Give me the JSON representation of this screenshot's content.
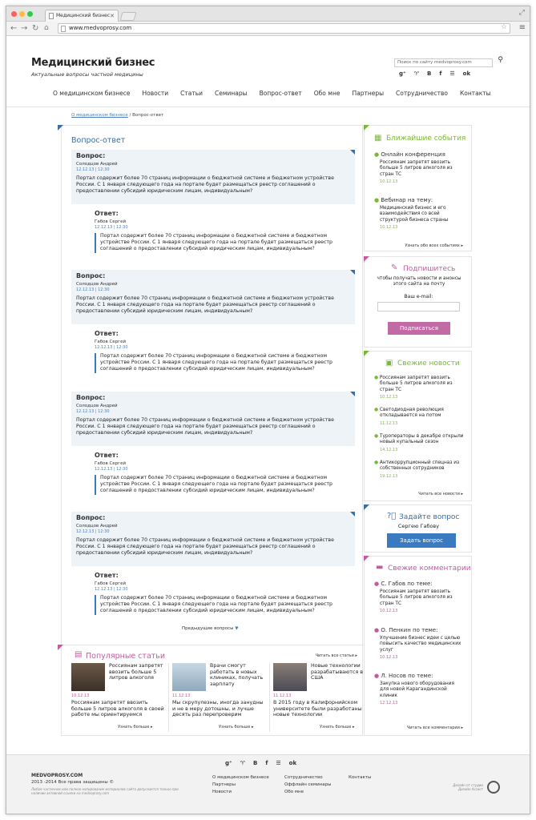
{
  "browser": {
    "tab_title": "Медицинский бизнес",
    "url": "www.medvoprosy.com"
  },
  "site": {
    "logo": "Медицинский бизнес",
    "tagline": "Актуальные вопросы частной медицины",
    "search_placeholder": "Поиск по сайту medvoprosy.com",
    "social": [
      "g⁺",
      "♈",
      "B",
      "f",
      "☰",
      "ok"
    ]
  },
  "nav": [
    "О медицинском бизнесе",
    "Новости",
    "Статьи",
    "Семинары",
    "Вопрос-ответ",
    "Обо мне",
    "Партнеры",
    "Сотрудничество",
    "Контакты"
  ],
  "breadcrumb": {
    "link": "О медицинском бизнесе",
    "sep": " / ",
    "current": "Вопрос-ответ"
  },
  "qa": {
    "title": "Вопрос-ответ",
    "q_label": "Вопрос:",
    "a_label": "Ответ:",
    "items": [
      {
        "q_author": "Солодцов Андрей",
        "q_date": "12.12.13 | 12:30",
        "q_text": "Портал содержит более 70 страниц информации о бюджетной системе и бюджетном устройстве России. С 1 января следующего года на портале будет размещаться реестр соглашений о предоставлении субсидий юридическим лицам, индивидуальным?",
        "a_author": "Габов Сергей",
        "a_date": "12.12.13 | 12:30",
        "a_text": "Портал содержит более 70 страниц информации о бюджетной системе и бюджетном устройстве России. С 1 января следующего года на портале будет размещаться реестр соглашений о предоставлении субсидий юридическим лицам, индивидуальным?"
      },
      {
        "q_author": "Солодцов Андрей",
        "q_date": "12.12.13 | 12:30",
        "q_text": "Портал содержит более 70 страниц информации о бюджетной системе и бюджетном устройстве России. С 1 января следующего года на портале будет размещаться реестр соглашений о предоставлении субсидий юридическим лицам, индивидуальным?",
        "a_author": "Габов Сергей",
        "a_date": "12.12.13 | 12:30",
        "a_text": "Портал содержит более 70 страниц информации о бюджетной системе и бюджетном устройстве России. С 1 января следующего года на портале будет размещаться реестр соглашений о предоставлении субсидий юридическим лицам, индивидуальным?"
      },
      {
        "q_author": "Солодцов Андрей",
        "q_date": "12.12.13 | 12:30",
        "q_text": "Портал содержит более 70 страниц информации о бюджетной системе и бюджетном устройстве России. С 1 января следующего года на портале будет размещаться реестр соглашений о предоставлении субсидий юридическим лицам, индивидуальным?",
        "a_author": "Габов Сергей",
        "a_date": "12.12.13 | 12:30",
        "a_text": "Портал содержит более 70 страниц информации о бюджетной системе и бюджетном устройстве России. С 1 января следующего года на портале будет размещаться реестр соглашений о предоставлении субсидий юридическим лицам, индивидуальным?"
      },
      {
        "q_author": "Солодцов Андрей",
        "q_date": "12.12.13 | 12:30",
        "q_text": "Портал содержит более 70 страниц информации о бюджетной системе и бюджетном устройстве России. С 1 января следующего года на портале будет размещаться реестр соглашений о предоставлении субсидий юридическим лицам, индивидуальным?",
        "a_author": "Габов Сергей",
        "a_date": "12.12.13 | 12:30",
        "a_text": "Портал содержит более 70 страниц информации о бюджетной системе и бюджетном устройстве России. С 1 января следующего года на портале будет размещаться реестр соглашений о предоставлении субсидий юридическим лицам, индивидуальным?"
      }
    ],
    "prev": "Предыдущие вопросы"
  },
  "popular": {
    "title": "Популярные статьи",
    "all": "Читать все статьи",
    "more": "Узнать больше",
    "cards": [
      {
        "t1": "Россиянам запретят ввозить больше 5 литров алкоголя",
        "date": "10.12.13",
        "t2": "Россиянам запретят ввозить больше 5 литров алкоголя в своей работе мы ориентируемся"
      },
      {
        "t1": "Врачи смогут работать в новых клиниках, получать зарплату",
        "date": "11.12.13",
        "t2": "Мы скрупулезны, иногда занудны и не в меру дотошны, и лучше десять раз перепроверим"
      },
      {
        "t1": "Новые технологии разрабатываются в США",
        "date": "11.12.13",
        "t2": "В 2015 году в Калифорнийском университете были разработаны новые технологии"
      }
    ]
  },
  "events": {
    "title": "Ближайшие события",
    "all": "Узнать обо всех событиях",
    "items": [
      {
        "head": "Онлайн конференция",
        "body": "Россиянам запретят ввозить больше 5 литров алкоголя из стран ТС",
        "date": "10.12.13"
      },
      {
        "head": "Вебинар на тему:",
        "body": "Медицинский бизнес и его взаимодействия со всей структурой бизнеса страны",
        "date": "10.12.13"
      }
    ]
  },
  "subscribe": {
    "title": "Подпишитесь",
    "text": "чтобы получать новости и анонсы этого сайта на почту",
    "email_label": "Ваш e-mail:",
    "button": "Подписаться"
  },
  "news": {
    "title": "Свежие новости",
    "all": "Читать все новости",
    "items": [
      {
        "body": "Россиянам запретят ввозить больше 5 литров алкоголя из стран ТС",
        "date": "10.12.13"
      },
      {
        "body": "Светодиодная революция откладывается на потом",
        "date": "11.12.13"
      },
      {
        "body": "Туроператоры в декабре открыли новый купальный сезон",
        "date": "14.12.13"
      },
      {
        "body": "Антикоррупционный спецназ из собственных сотрудников",
        "date": "19.12.13"
      }
    ]
  },
  "ask": {
    "title": "Задайте вопрос",
    "sub": "Сергею Габову",
    "button": "Задать вопрос"
  },
  "comments": {
    "title": "Свежие комментарии",
    "all": "Читать все комментарии",
    "items": [
      {
        "head": "С. Габов по теме:",
        "body": "Россиянам запретят ввозить больше 5 литров алкоголя из стран ТС",
        "date": "10.12.13"
      },
      {
        "head": "О. Пенкин по теме:",
        "body": "Улучшение бизнес идеи с целью повысить качество медицинских услуг",
        "date": "10.12.13"
      },
      {
        "head": "Л. Носов по теме:",
        "body": "Закупка нового оборудования для новой Карагандинской клиник",
        "date": "12.12.13"
      }
    ]
  },
  "footer": {
    "site": "MEDVOPROSY.COM",
    "copy": "2013 -2014 Все права защищены ©",
    "note": "Любое частичное или полное копирование материалов сайта допускается только при наличии активной ссылки на medvoprosy.com",
    "col1": [
      "О медицинском бизнесе",
      "Партнеры",
      "Новости"
    ],
    "col2": [
      "Сотрудничество",
      "Оффлайн семинары",
      "Обо мне"
    ],
    "col3": [
      "Контакты"
    ],
    "design": "Дизайн от студии Дизайн Ассист"
  },
  "colors": {
    "blue": "#3a6ea5",
    "green": "#7ab839",
    "magenta": "#c45aa0",
    "button_blue": "#3a7ac0",
    "button_pink": "#c26aa6"
  }
}
